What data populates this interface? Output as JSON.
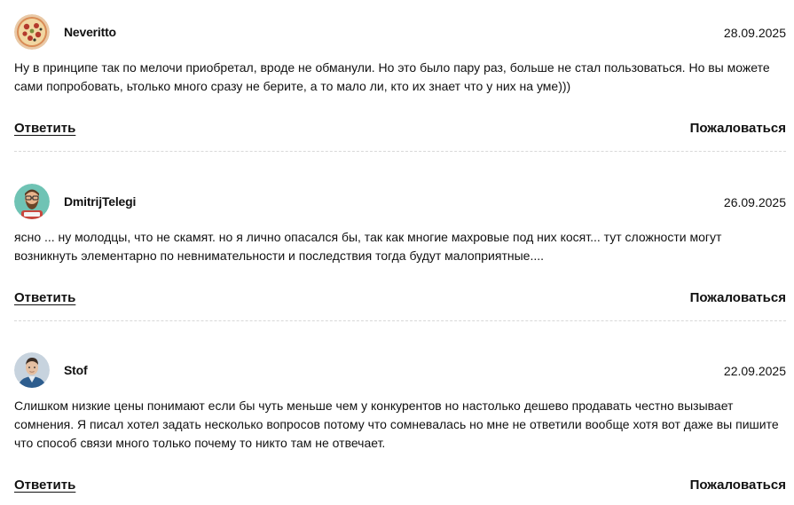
{
  "comments": [
    {
      "author": "Neveritto",
      "date": "28.09.2025",
      "avatar_icon": "pizza-avatar-icon",
      "text": "Ну в принципе так по мелочи приобретал, вроде не обманули. Но это было пару раз, больше не стал пользоваться. Но вы можете сами попробовать, ьтолько много сразу не берите, а то мало ли, кто их знает что у них на уме)))",
      "reply_label": "Ответить",
      "report_label": "Пожаловаться"
    },
    {
      "author": "DmitrijTelegi",
      "date": "26.09.2025",
      "avatar_icon": "bearded-man-avatar-icon",
      "text": "ясно ... ну молодцы, что не скамят. но я лично опасался бы, так как многие махровые под них косят... тут сложности могут возникнуть элементарно по невнимательности и последствия тогда будут малоприятные....",
      "reply_label": "Ответить",
      "report_label": "Пожаловаться"
    },
    {
      "author": "Stof",
      "date": "22.09.2025",
      "avatar_icon": "person-photo-avatar-icon",
      "text": "Слишком низкие цены понимают если бы чуть меньше чем у конкурентов но настолько дешево продавать честно вызывает сомнения. Я писал хотел задать несколько вопросов потому что сомневалась но мне не ответили вообще хотя вот даже вы пишите что способ связи много только почему то никто там не отвечает.",
      "reply_label": "Ответить",
      "report_label": "Пожаловаться"
    }
  ],
  "colors": {
    "text": "#111111",
    "divider": "#d8d8d8",
    "background": "#ffffff"
  }
}
